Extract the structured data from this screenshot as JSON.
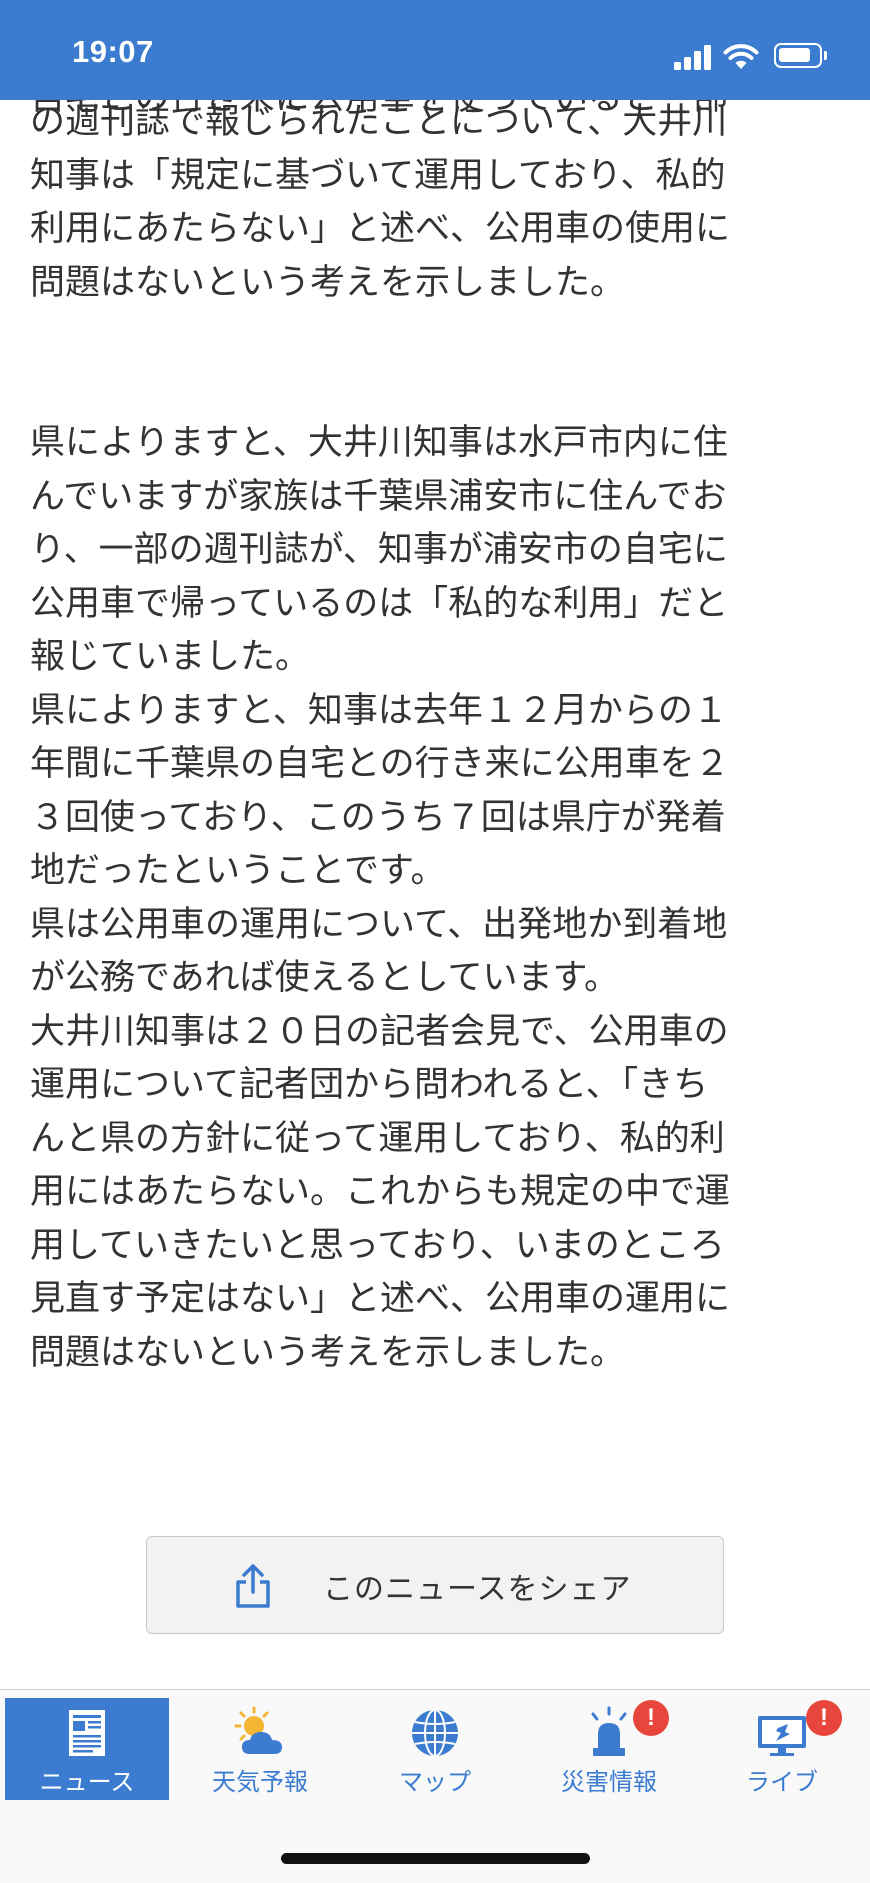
{
  "status_bar": {
    "time": "19:07"
  },
  "article": {
    "clipped_top_line": "自宅との行き来に公用車を使っていると一部",
    "paragraphs": [
      "の週刊誌で報じられたことについて、大井川\n知事は「規定に基づいて運用しており、私的\n利用にあたらない」と述べ、公用車の使用に\n問題はないという考えを示しました。",
      "県によりますと、大井川知事は水戸市内に住\nんでいますが家族は千葉県浦安市に住んでお\nり、一部の週刊誌が、知事が浦安市の自宅に\n公用車で帰っているのは「私的な利用」だと\n報じていました。",
      "県によりますと、知事は去年１２月からの１\n年間に千葉県の自宅との行き来に公用車を２\n３回使っており、このうち７回は県庁が発着\n地だったということです。",
      "県は公用車の運用について、出発地か到着地\nが公務であれば使えるとしています。",
      "大井川知事は２０日の記者会見で、公用車の\n運用について記者団から問われると、「きち\nんと県の方針に従って運用しており、私的利\n用にはあたらない。これからも規定の中で運\n用していきたいと思っており、いまのところ\n見直す予定はない」と述べ、公用車の運用に\n問題はないという考えを示しました。"
    ]
  },
  "share": {
    "label": "このニュースをシェア",
    "icon": "share-icon"
  },
  "tabs": [
    {
      "label": "ニュース",
      "icon": "news-icon",
      "active": true,
      "badge": ""
    },
    {
      "label": "天気予報",
      "icon": "weather-icon",
      "active": false,
      "badge": ""
    },
    {
      "label": "マップ",
      "icon": "globe-icon",
      "active": false,
      "badge": ""
    },
    {
      "label": "災害情報",
      "icon": "siren-icon",
      "active": false,
      "badge": "!"
    },
    {
      "label": "ライブ",
      "icon": "live-tv-icon",
      "active": false,
      "badge": "!"
    }
  ],
  "colors": {
    "brand_blue": "#3b7cd0",
    "badge_red": "#e8453c",
    "text": "#333333"
  }
}
